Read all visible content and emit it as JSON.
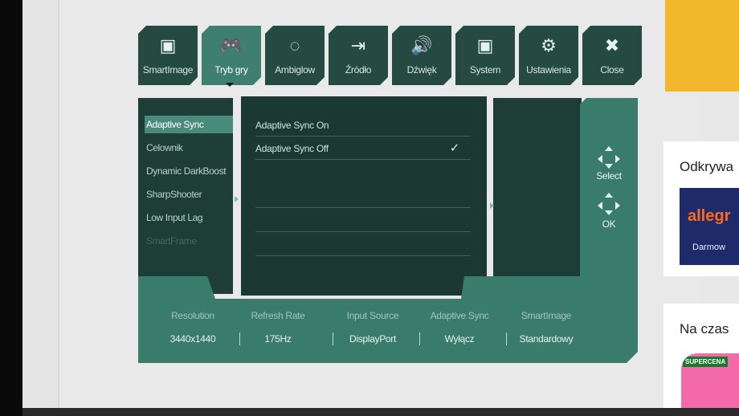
{
  "tabs": [
    {
      "icon": "smartimage-icon",
      "glyph": "▣",
      "label": "SmartImage",
      "active": false
    },
    {
      "icon": "gamepad-icon",
      "glyph": "🎮",
      "label": "Tryb gry",
      "active": true
    },
    {
      "icon": "ambiglow-icon",
      "glyph": "◌",
      "label": "Ambiglow",
      "active": false
    },
    {
      "icon": "input-source-icon",
      "glyph": "⇥",
      "label": "Źródło",
      "active": false
    },
    {
      "icon": "speaker-icon",
      "glyph": "🔊",
      "label": "Dźwięk",
      "active": false
    },
    {
      "icon": "system-icon",
      "glyph": "▣",
      "label": "System",
      "active": false
    },
    {
      "icon": "gear-icon",
      "glyph": "⚙",
      "label": "Ustawienia",
      "active": false
    },
    {
      "icon": "close-icon",
      "glyph": "✖",
      "label": "Close",
      "active": false
    }
  ],
  "menu": [
    {
      "label": "Adaptive Sync",
      "state": "selected"
    },
    {
      "label": "Celownik",
      "state": "normal"
    },
    {
      "label": "Dynamic DarkBoost",
      "state": "normal"
    },
    {
      "label": "SharpShooter",
      "state": "normal"
    },
    {
      "label": "Low Input Lag",
      "state": "normal"
    },
    {
      "label": "SmartFrame",
      "state": "disabled"
    }
  ],
  "options": [
    {
      "label": "Adaptive Sync On",
      "checked": false
    },
    {
      "label": "Adaptive Sync Off",
      "checked": true
    }
  ],
  "check_glyph": "✓",
  "nav": {
    "select_label": "Select",
    "ok_label": "OK"
  },
  "info": {
    "headers": [
      "Resolution",
      "Refresh Rate",
      "Input Source",
      "Adaptive Sync",
      "SmartImage"
    ],
    "values": [
      "3440x1440",
      "175Hz",
      "DisplayPort",
      "Wyłącz",
      "Standardowy"
    ]
  },
  "web": {
    "heading1": "Odkrywa",
    "brand": "allegr",
    "brand_sub": "Darmow",
    "heading2": "Na czas",
    "promo_tag": "SUPERCENA"
  },
  "colors": {
    "osd_panel": "#1f3d37",
    "osd_accent": "#3a7c6c",
    "selected": "#4a8a7b",
    "banner": "#f2b72a",
    "allegro": "#ff6a1a"
  }
}
